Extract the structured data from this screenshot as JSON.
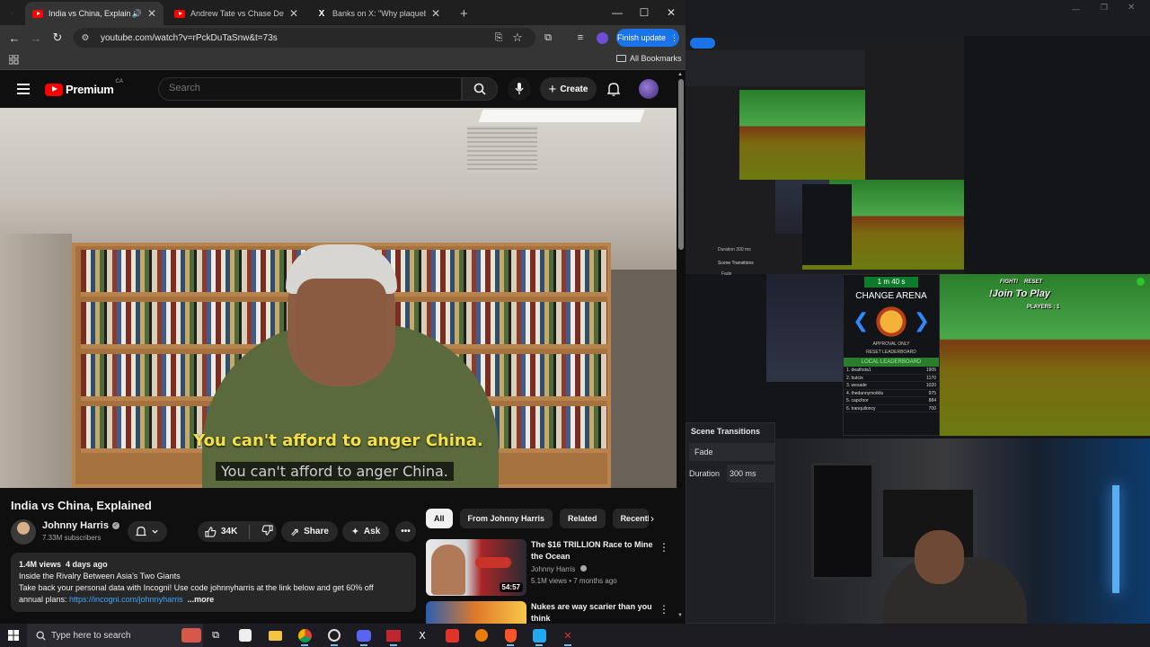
{
  "browser": {
    "tabs": [
      {
        "title": "India vs China, Explained - Yo",
        "active": true,
        "favicon": "youtube-icon"
      },
      {
        "title": "Andrew Tate vs Chase DeMoor",
        "active": false,
        "favicon": "youtube-icon"
      },
      {
        "title": "Banks on X: \"Why plaqueboymax",
        "active": false,
        "favicon": "x-icon"
      }
    ],
    "url": "youtube.com/watch?v=rPckDuTaSnw&t=73s",
    "finish_update": "Finish update",
    "all_bookmarks": "All Bookmarks"
  },
  "youtube": {
    "logo_text": "Premium",
    "region": "CA",
    "search_placeholder": "Search",
    "create_label": "Create",
    "captions": {
      "primary": "You can't afford to anger China.",
      "secondary": "You can't afford to anger China."
    },
    "video_title": "India vs China, Explained",
    "channel": {
      "name": "Johnny Harris",
      "subscribers": "7.33M subscribers"
    },
    "actions": {
      "likes": "34K",
      "share": "Share",
      "ask": "Ask"
    },
    "description": {
      "views": "1.4M views",
      "age": "4 days ago",
      "line1": "Inside the Rivalry Between Asia's Two Giants",
      "line2": "Take back your personal data with Incogni! Use code johnnyharris at the link below and get 60% off",
      "line3_prefix": "annual plans: ",
      "link": "https://incogni.com/johnnyharris",
      "more": "...more"
    },
    "chips": [
      "All",
      "From Johnny Harris",
      "Related",
      "Recently"
    ],
    "recommendations": [
      {
        "title": "The $16 TRILLION Race to Mine the Ocean",
        "channel": "Johnny Harris",
        "meta": "5.1M views • 7 months ago",
        "duration": "54:57"
      },
      {
        "title": "Nukes are way scarier than you think",
        "channel": "",
        "meta": "",
        "duration": ""
      }
    ]
  },
  "stream": {
    "timer": "1 m 40 s",
    "change_arena": "CHANGE ARENA",
    "approval": "APPROVAL ONLY",
    "reset_leaderboard": "RESET LEADERBOARD",
    "local_leaderboard": "LOCAL LEADERBOARD",
    "leaderboard": [
      {
        "rank": "1. deathsta1",
        "score": "1905"
      },
      {
        "rank": "2. butcix",
        "score": "1170"
      },
      {
        "rank": "3. wesade",
        "score": "1020"
      },
      {
        "rank": "4. thedannymotkla",
        "score": "975"
      },
      {
        "rank": "5. capcfoor",
        "score": "884"
      },
      {
        "rank": "6. tranquiloncy",
        "score": "700"
      }
    ],
    "fight": "FIGHT!",
    "reset": "RESET",
    "join": "!Join To Play",
    "players": "PLAYERS : 1",
    "scene_transitions": "Scene Transitions",
    "fade": "Fade",
    "duration_label": "Duration",
    "duration_value": "300 ms",
    "mini_scene": "Scene Transitions",
    "mini_fade": "Fade",
    "mini_duration": "Duration",
    "mini_duration_value": "300 ms"
  },
  "taskbar": {
    "search_placeholder": "Type here to search"
  },
  "colors": {
    "youtube_red": "#ff0000",
    "link_blue": "#3ea6ff",
    "finish_blue": "#1a73e8",
    "caption_yellow": "#f4e14a"
  }
}
